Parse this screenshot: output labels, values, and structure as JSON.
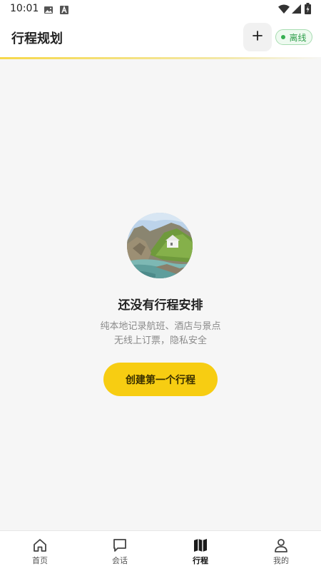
{
  "status_bar": {
    "time": "10:01",
    "left_icons": [
      "image-icon",
      "a-icon"
    ],
    "right_icons": [
      "wifi-icon",
      "signal-icon",
      "battery-charging-icon"
    ]
  },
  "header": {
    "title": "行程规划",
    "add_icon": "plus-icon",
    "offline_badge": "离线",
    "offline_color": "#2e9e4a",
    "accent_line_color": "#f6d84a"
  },
  "empty_state": {
    "illustration": "coastal-house-photo",
    "title": "还没有行程安排",
    "subtitle_line1": "纯本地记录航班、酒店与景点",
    "subtitle_line2": "无线上订票，隐私安全",
    "create_button": "创建第一个行程",
    "button_color": "#f7cd12"
  },
  "bottom_nav": {
    "items": [
      {
        "label": "首页",
        "icon": "home-icon",
        "active": false
      },
      {
        "label": "会话",
        "icon": "chat-icon",
        "active": false
      },
      {
        "label": "行程",
        "icon": "map-icon",
        "active": true
      },
      {
        "label": "我的",
        "icon": "person-icon",
        "active": false
      }
    ]
  }
}
